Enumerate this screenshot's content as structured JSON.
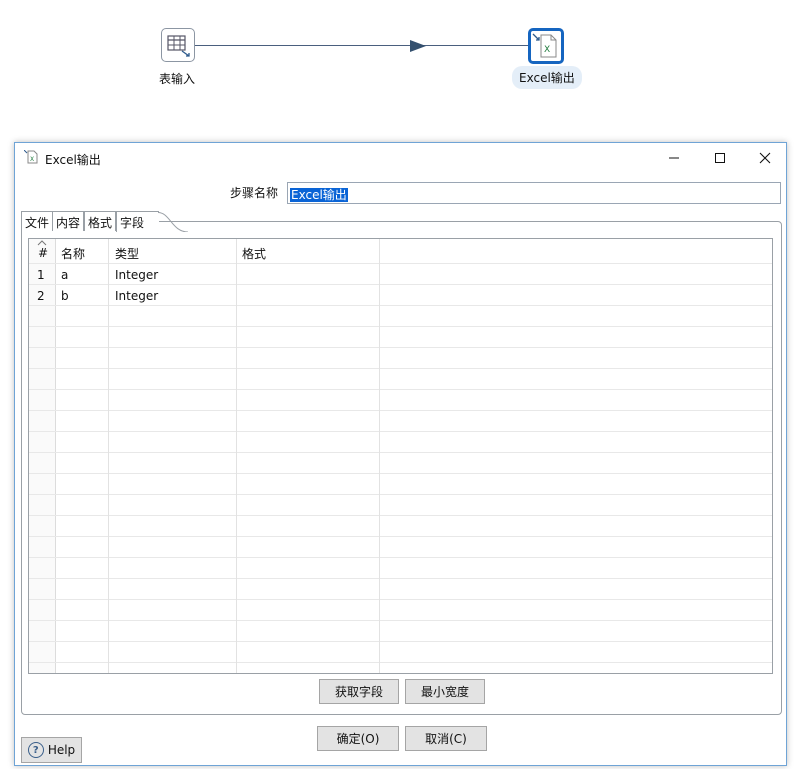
{
  "canvas": {
    "steps": [
      {
        "label": "表输入",
        "icon": "table-input-icon"
      },
      {
        "label": "Excel输出",
        "icon": "excel-output-icon"
      }
    ]
  },
  "dialog": {
    "title": "Excel输出",
    "step_name_label": "步骤名称",
    "step_name_value": "Excel输出",
    "tabs": [
      "文件",
      "内容",
      "格式",
      "字段"
    ],
    "active_tab": "字段",
    "columns": [
      "#",
      "名称",
      "类型",
      "格式"
    ],
    "rows": [
      {
        "num": "1",
        "name": "a",
        "type": "Integer",
        "format": ""
      },
      {
        "num": "2",
        "name": "b",
        "type": "Integer",
        "format": ""
      }
    ],
    "get_fields_button": "获取字段",
    "min_width_button": "最小宽度",
    "ok_button": "确定(O)",
    "cancel_button": "取消(C)",
    "help_button": "Help"
  },
  "colors": {
    "accent": "#1565c0",
    "selection": "#0a64d6"
  }
}
